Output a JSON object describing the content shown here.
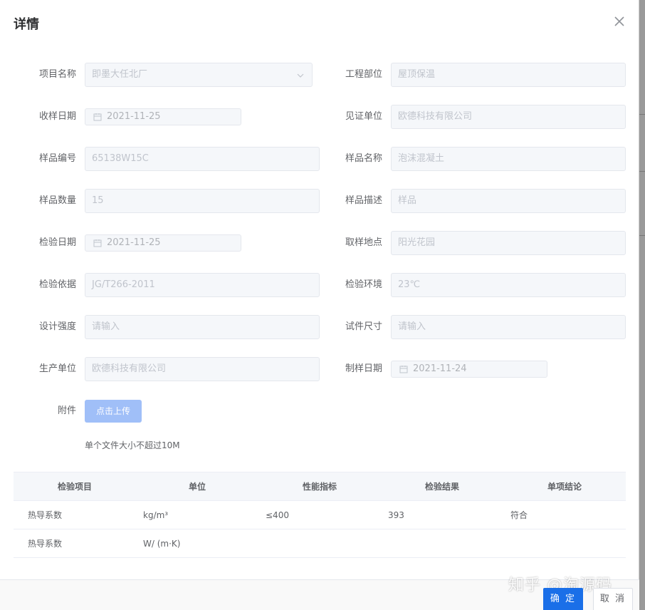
{
  "dialog": {
    "title": "详情",
    "close_icon": "close-icon"
  },
  "form": {
    "left": [
      {
        "label": "项目名称",
        "value": "即墨大任北厂",
        "type": "select"
      },
      {
        "label": "收样日期",
        "value": "2021-11-25",
        "type": "date"
      },
      {
        "label": "样品编号",
        "value": "65138W15C",
        "type": "text"
      },
      {
        "label": "样品数量",
        "value": "15",
        "type": "text"
      },
      {
        "label": "检验日期",
        "value": "2021-11-25",
        "type": "date"
      },
      {
        "label": "检验依据",
        "value": "JG/T266-2011",
        "type": "text"
      },
      {
        "label": "设计强度",
        "placeholder": "请输入",
        "type": "text"
      },
      {
        "label": "生产单位",
        "value": "欧德科技有限公司",
        "type": "text"
      }
    ],
    "right": [
      {
        "label": "工程部位",
        "value": "屋顶保温",
        "type": "text"
      },
      {
        "label": "见证单位",
        "value": "欧德科技有限公司",
        "type": "text"
      },
      {
        "label": "样品名称",
        "value": "泡沫混凝土",
        "type": "text"
      },
      {
        "label": "样品描述",
        "value": "样品",
        "type": "text"
      },
      {
        "label": "取样地点",
        "value": "阳光花园",
        "type": "text"
      },
      {
        "label": "检验环境",
        "value": "23℃",
        "type": "text"
      },
      {
        "label": "试件尺寸",
        "placeholder": "请输入",
        "type": "text"
      },
      {
        "label": "制样日期",
        "value": "2021-11-24",
        "type": "date"
      }
    ],
    "attachment": {
      "label": "附件",
      "upload_label": "点击上传",
      "tip": "单个文件大小不超过10M"
    }
  },
  "table": {
    "headers": [
      "检验项目",
      "单位",
      "性能指标",
      "检验结果",
      "单项结论"
    ],
    "rows": [
      [
        "热导系数",
        "kg/m³",
        "≤400",
        "393",
        "符合"
      ],
      [
        "热导系数",
        "W/ (m·K)",
        "",
        "",
        ""
      ]
    ]
  },
  "footer": {
    "confirm_label": "确 定",
    "cancel_label": "取 消",
    "watermark": "知乎 @淘源码"
  },
  "colors": {
    "primary": "#1a6fe8",
    "upload_disabled": "#a0bff8"
  }
}
